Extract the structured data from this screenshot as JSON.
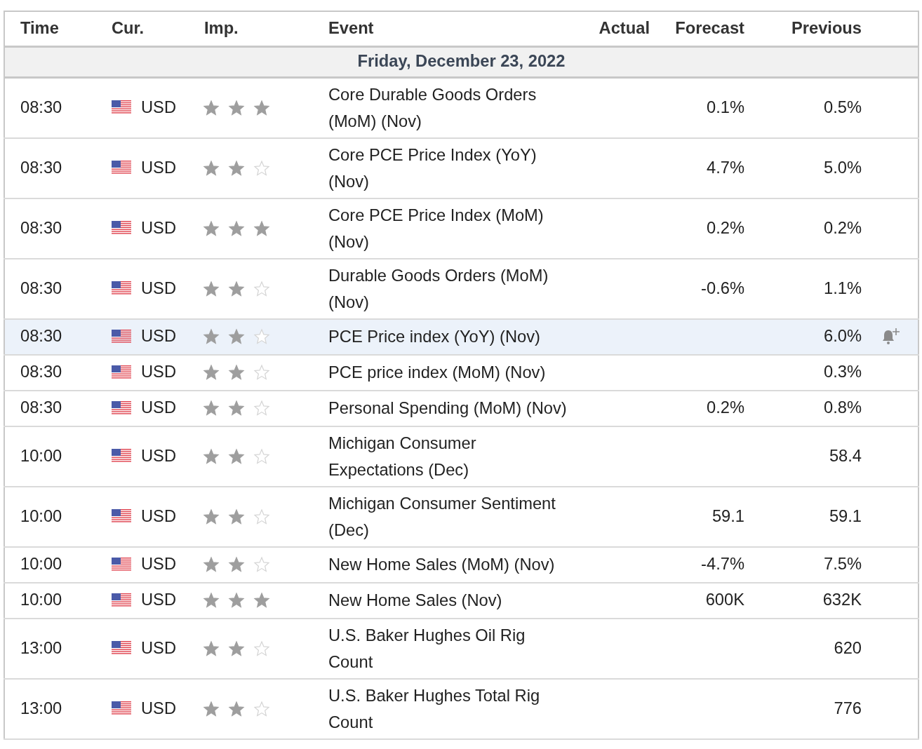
{
  "columns": [
    "Time",
    "Cur.",
    "Imp.",
    "Event",
    "Actual",
    "Forecast",
    "Previous"
  ],
  "date_header": "Friday, December 23, 2022",
  "rows": [
    {
      "time": "08:30",
      "currency": "USD",
      "stars": 3,
      "event": "Core Durable Goods Orders (MoM) (Nov)",
      "forecast": "0.1%",
      "previous": "0.5%",
      "selected": false
    },
    {
      "time": "08:30",
      "currency": "USD",
      "stars": 2,
      "event": "Core PCE Price Index (YoY) (Nov)",
      "forecast": "4.7%",
      "previous": "5.0%",
      "selected": false
    },
    {
      "time": "08:30",
      "currency": "USD",
      "stars": 3,
      "event": "Core PCE Price Index (MoM) (Nov)",
      "forecast": "0.2%",
      "previous": "0.2%",
      "selected": false
    },
    {
      "time": "08:30",
      "currency": "USD",
      "stars": 2,
      "event": "Durable Goods Orders (MoM) (Nov)",
      "forecast": "-0.6%",
      "previous": "1.1%",
      "selected": false
    },
    {
      "time": "08:30",
      "currency": "USD",
      "stars": 2,
      "event": "PCE Price index (YoY) (Nov)",
      "previous": "6.0%",
      "selected": true
    },
    {
      "time": "08:30",
      "currency": "USD",
      "stars": 2,
      "event": "PCE price index (MoM) (Nov)",
      "previous": "0.3%",
      "selected": false
    },
    {
      "time": "08:30",
      "currency": "USD",
      "stars": 2,
      "event": "Personal Spending (MoM) (Nov)",
      "forecast": "0.2%",
      "previous": "0.8%",
      "selected": false
    },
    {
      "time": "10:00",
      "currency": "USD",
      "stars": 2,
      "event": "Michigan Consumer Expectations (Dec)",
      "previous": "58.4",
      "selected": false
    },
    {
      "time": "10:00",
      "currency": "USD",
      "stars": 2,
      "event": "Michigan Consumer Sentiment (Dec)",
      "forecast": "59.1",
      "previous": "59.1",
      "selected": false
    },
    {
      "time": "10:00",
      "currency": "USD",
      "stars": 2,
      "event": "New Home Sales (MoM) (Nov)",
      "forecast": "-4.7%",
      "previous": "7.5%",
      "selected": false
    },
    {
      "time": "10:00",
      "currency": "USD",
      "stars": 3,
      "event": "New Home Sales (Nov)",
      "forecast": "600K",
      "previous": "632K",
      "selected": false
    },
    {
      "time": "13:00",
      "currency": "USD",
      "stars": 2,
      "event": "U.S. Baker Hughes Oil Rig Count",
      "previous": "620",
      "selected": false
    },
    {
      "time": "13:00",
      "currency": "USD",
      "stars": 2,
      "event": "U.S. Baker Hughes Total Rig Count",
      "previous": "776",
      "selected": false
    }
  ]
}
